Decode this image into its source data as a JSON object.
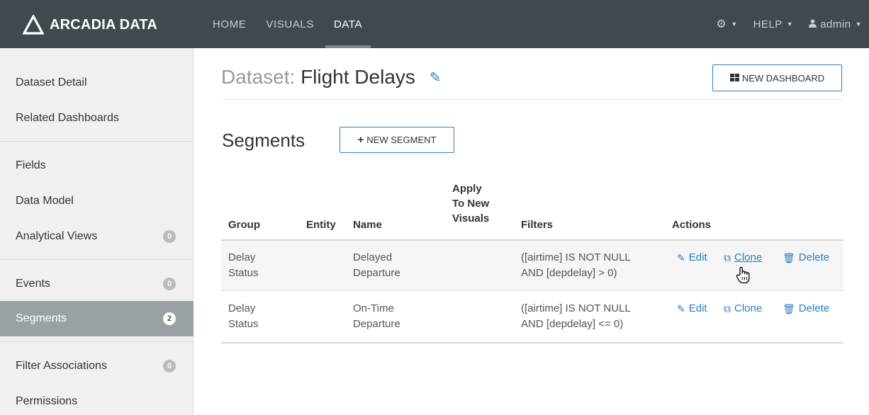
{
  "brand": {
    "name": "ARCADIA DATA"
  },
  "nav": {
    "items": [
      {
        "label": "HOME",
        "active": false
      },
      {
        "label": "VISUALS",
        "active": false
      },
      {
        "label": "DATA",
        "active": true
      }
    ],
    "help_label": "HELP",
    "user_label": "admin"
  },
  "sidebar": {
    "items": [
      {
        "label": "Dataset Detail"
      },
      {
        "label": "Related Dashboards"
      },
      {
        "label": "Fields"
      },
      {
        "label": "Data Model"
      },
      {
        "label": "Analytical Views",
        "count": "0"
      },
      {
        "label": "Events",
        "count": "0"
      },
      {
        "label": "Segments",
        "count": "2",
        "active": true
      },
      {
        "label": "Filter Associations",
        "count": "0"
      },
      {
        "label": "Permissions"
      }
    ]
  },
  "dataset": {
    "prefix": "Dataset:",
    "name": "Flight Delays"
  },
  "new_dashboard_label": "NEW DASHBOARD",
  "segments": {
    "title": "Segments",
    "new_segment_label": "NEW SEGMENT",
    "columns": {
      "group": "Group",
      "entity": "Entity",
      "name": "Name",
      "apply": [
        "Apply",
        "To New",
        "Visuals"
      ],
      "filters": "Filters",
      "actions": "Actions"
    },
    "rows": [
      {
        "group": [
          "Delay",
          "Status"
        ],
        "entity": "",
        "name": [
          "Delayed",
          "Departure"
        ],
        "filters": [
          "([airtime] IS NOT NULL",
          "AND [depdelay] > 0)"
        ]
      },
      {
        "group": [
          "Delay",
          "Status"
        ],
        "entity": "",
        "name": [
          "On-Time",
          "Departure"
        ],
        "filters": [
          "([airtime] IS NOT NULL",
          "AND [depdelay] <= 0)"
        ]
      }
    ],
    "actions": {
      "edit": "Edit",
      "clone": "Clone",
      "delete": "Delete"
    }
  },
  "colors": {
    "topbar": "#3f4a4f",
    "link": "#2d7fc1",
    "sidebar_active": "#9aa1a5"
  }
}
